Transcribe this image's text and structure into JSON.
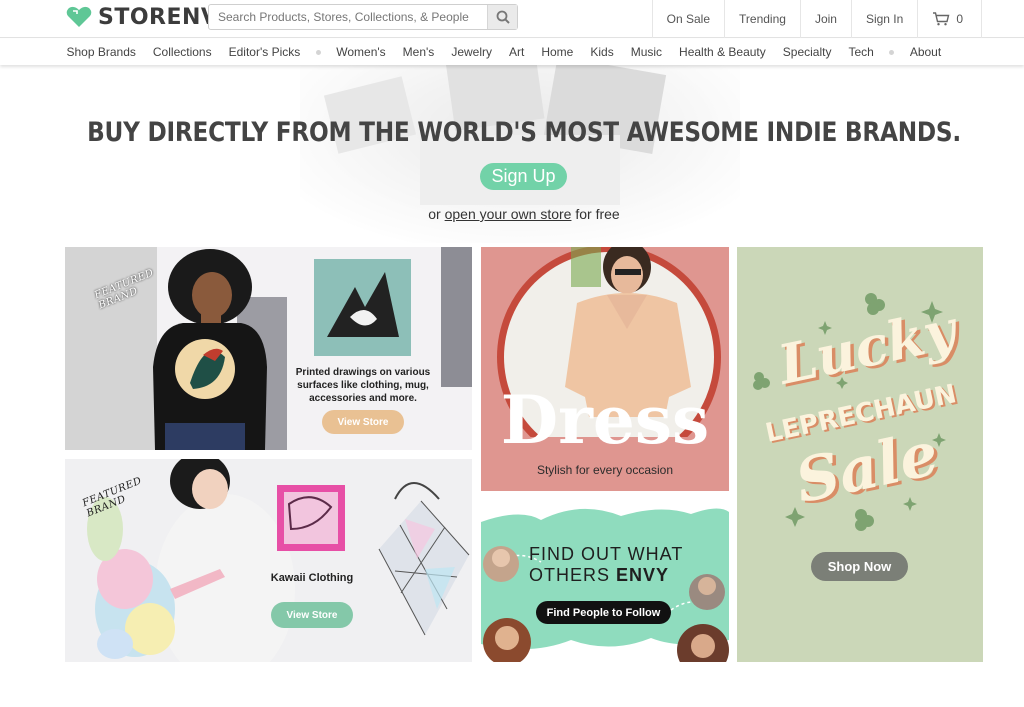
{
  "header": {
    "logo_text": "STORENVY",
    "search_placeholder": "Search Products, Stores, Collections, & People",
    "links": [
      "On Sale",
      "Trending",
      "Join",
      "Sign In"
    ],
    "cart_count": "0"
  },
  "nav": {
    "categories_a": [
      "Shop Brands",
      "Collections",
      "Editor's Picks"
    ],
    "categories_b": [
      "Women's",
      "Men's",
      "Jewelry",
      "Art",
      "Home",
      "Kids",
      "Music",
      "Health & Beauty",
      "Specialty",
      "Tech"
    ],
    "categories_c": [
      "About"
    ]
  },
  "hero": {
    "title": "BUY DIRECTLY FROM THE WORLD'S MOST AWESOME INDIE BRANDS.",
    "signup_label": "Sign Up",
    "sub_prefix": "or",
    "sub_link": "open your own store",
    "sub_suffix": "for free"
  },
  "cards": {
    "featured1": {
      "badge": "FEATURED BRAND",
      "description": "Printed drawings on various surfaces like clothing, mug, accessories and more.",
      "button": "View Store"
    },
    "featured2": {
      "badge": "FEATURED BRAND",
      "title": "Kawaii Clothing",
      "button": "View Store"
    },
    "dress": {
      "title": "Dress",
      "subtitle": "Stylish for every occasion"
    },
    "envy": {
      "line1": "FIND OUT WHAT",
      "line2_prefix": "OTHERS ",
      "line2_bold": "ENVY",
      "button": "Find People to Follow"
    },
    "lucky": {
      "word1": "Lucky",
      "word2": "LEPRECHAUN",
      "word3": "Sale",
      "button": "Shop Now"
    }
  },
  "colors": {
    "accent": "#72d2a8",
    "dress_bg": "#df9690",
    "lucky_bg": "#cbd7b8",
    "envy_green": "#8fdcbe",
    "view_store_tan": "#e9c193",
    "view_store_green": "#84c8a9"
  }
}
